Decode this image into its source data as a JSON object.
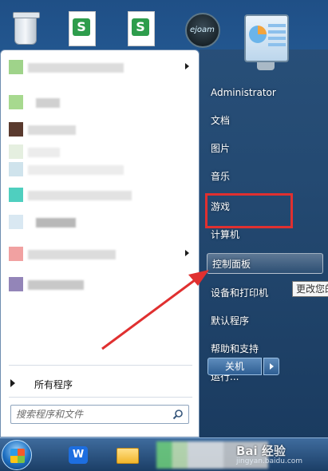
{
  "desktop": {
    "icons": [
      {
        "name": "recycle-bin",
        "label": ""
      },
      {
        "name": "spreadsheet-doc-1",
        "badge": "S"
      },
      {
        "name": "spreadsheet-doc-2",
        "badge": "S"
      },
      {
        "name": "ejoam-app",
        "label": "ejoam"
      },
      {
        "name": "control-panel-icon",
        "label": ""
      }
    ]
  },
  "start_menu": {
    "all_programs_label": "所有程序",
    "search": {
      "placeholder": "搜索程序和文件",
      "value": ""
    },
    "right_items": [
      {
        "label": "Administrator"
      },
      {
        "label": "文档"
      },
      {
        "label": "图片"
      },
      {
        "label": "音乐"
      },
      {
        "label": "游戏"
      },
      {
        "label": "计算机"
      },
      {
        "label": "控制面板",
        "selected": true
      },
      {
        "label": "设备和打印机"
      },
      {
        "label": "默认程序"
      },
      {
        "label": "帮助和支持"
      },
      {
        "label": "运行..."
      }
    ],
    "shutdown_label": "关机",
    "tooltip": "更改您的"
  },
  "colors": {
    "annotation_red": "#e03030",
    "menu_border": "#6f8db0"
  },
  "taskbar": {
    "wps_label": "W"
  },
  "watermark": {
    "main": "Bai 经验",
    "sub": "jingyan.baidu.com"
  }
}
